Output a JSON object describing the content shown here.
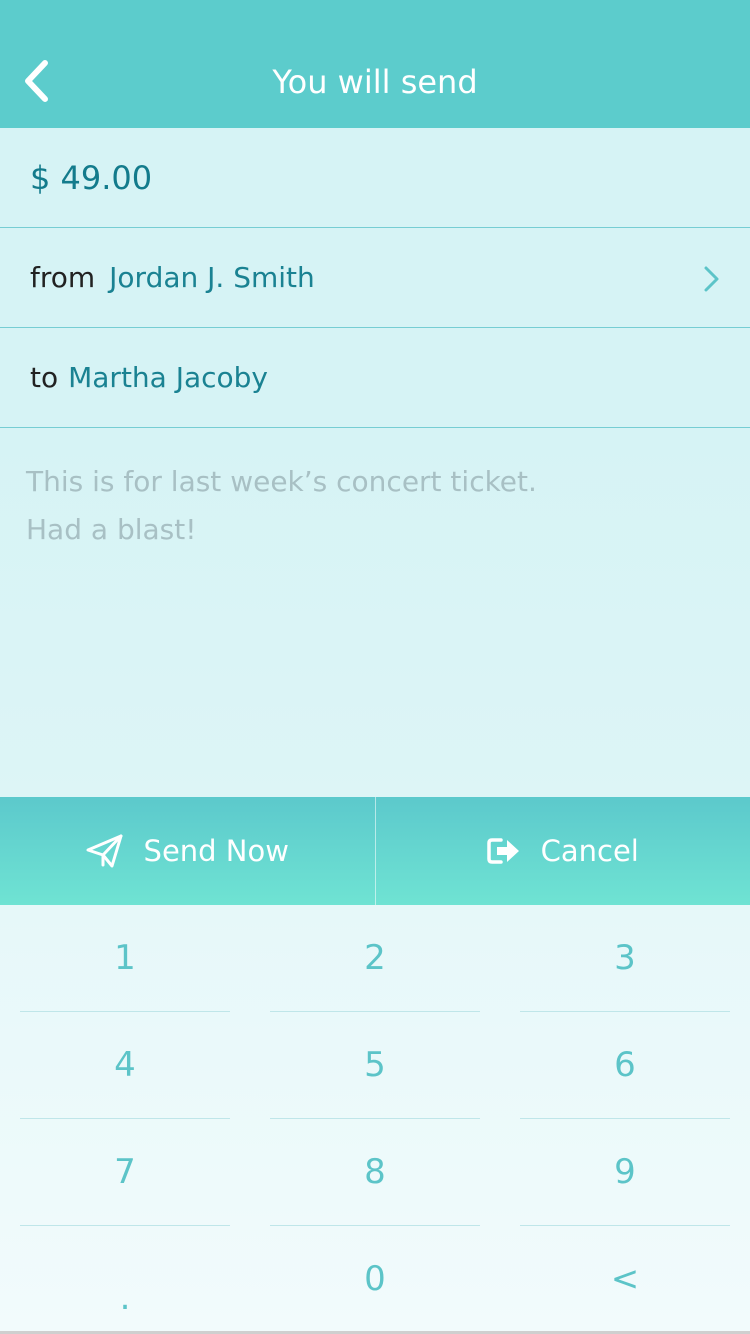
{
  "header": {
    "title": "You will send",
    "back_icon": "chevron-left-icon"
  },
  "transfer": {
    "amount": "$ 49.00",
    "from_prefix": "from",
    "from_name": "Jordan J. Smith",
    "to_prefix": "to",
    "to_name": "Martha Jacoby"
  },
  "memo": {
    "line1": "This is for last week’s concert ticket.",
    "line2": "Had a blast!"
  },
  "actions": {
    "send_label": "Send Now",
    "send_icon": "paper-plane-icon",
    "cancel_label": "Cancel",
    "cancel_icon": "exit-icon"
  },
  "keypad": {
    "keys": [
      "1",
      "2",
      "3",
      "4",
      "5",
      "6",
      "7",
      "8",
      "9",
      ".",
      "0",
      "<"
    ]
  },
  "colors": {
    "header_bg": "#5ccccc",
    "row_bg": "#d6f3f5",
    "accent_text": "#1a8292",
    "keypad_digit": "#5cc4c8"
  }
}
